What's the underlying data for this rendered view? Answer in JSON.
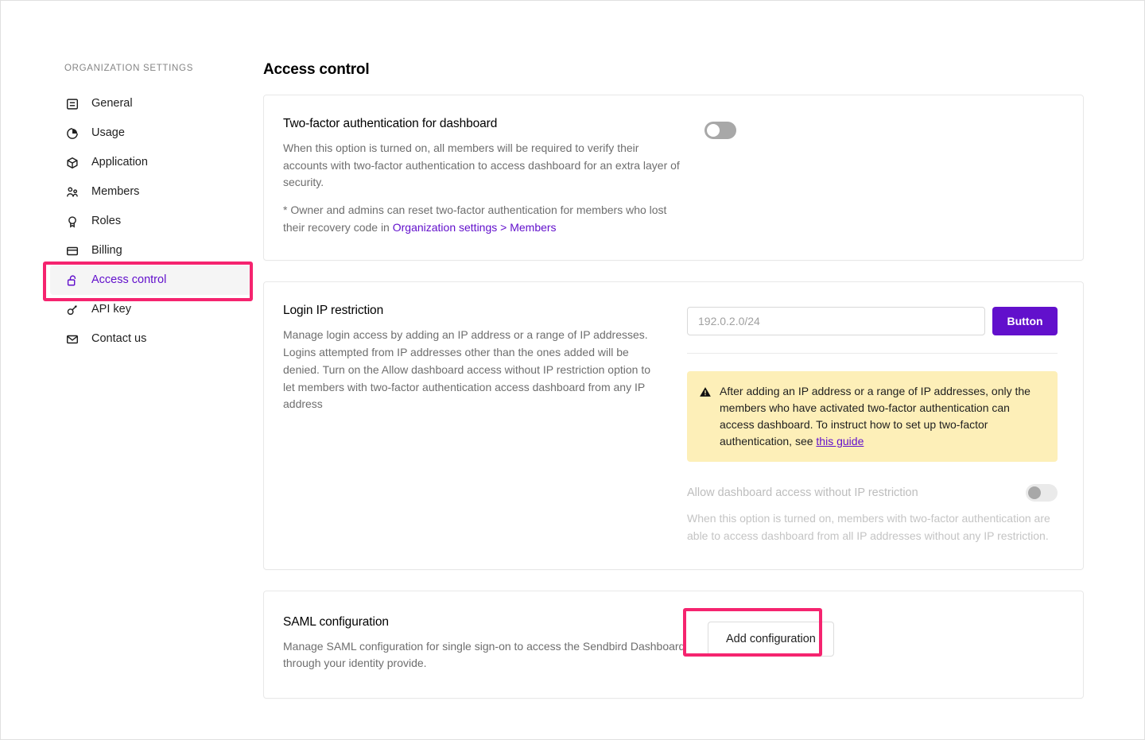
{
  "sidebar": {
    "heading": "ORGANIZATION SETTINGS",
    "items": [
      {
        "label": "General",
        "icon": "document-icon",
        "active": false
      },
      {
        "label": "Usage",
        "icon": "pie-chart-icon",
        "active": false
      },
      {
        "label": "Application",
        "icon": "cube-icon",
        "active": false
      },
      {
        "label": "Members",
        "icon": "members-icon",
        "active": false
      },
      {
        "label": "Roles",
        "icon": "badge-icon",
        "active": false
      },
      {
        "label": "Billing",
        "icon": "credit-card-icon",
        "active": false
      },
      {
        "label": "Access control",
        "icon": "unlock-icon",
        "active": true
      },
      {
        "label": "API key",
        "icon": "key-icon",
        "active": false
      },
      {
        "label": "Contact us",
        "icon": "envelope-icon",
        "active": false
      }
    ]
  },
  "main": {
    "page_title": "Access control",
    "two_factor": {
      "title": "Two-factor authentication for dashboard",
      "description": "When this option is turned on, all members will be required to verify their accounts with two-factor authentication to access dashboard for an extra layer of security.",
      "note_prefix": "* Owner and admins can reset two-factor authentication for members who lost their recovery code in ",
      "note_link": "Organization settings > Members",
      "toggle_state": "off"
    },
    "login_ip": {
      "title": "Login IP restriction",
      "description": "Manage login access by adding an IP address or a range of IP addresses. Logins attempted from IP addresses other than the ones added will be denied. Turn on the Allow dashboard access without IP restriction option to let members with two-factor authentication access dashboard from any IP address",
      "input_placeholder": "192.0.2.0/24",
      "input_value": "",
      "button_label": "Button",
      "warning_icon": "warning-triangle-icon",
      "warning_text": "After adding an IP address or a range of IP addresses, only the members who have activated two-factor authentication can access dashboard. To instruct how to set up two-factor authentication, see ",
      "warning_link": "this guide",
      "allow_title": "Allow dashboard access without IP restriction",
      "allow_body": "When this option is turned on, members with two-factor authentication are able to access dashboard from all IP addresses without any IP restriction.",
      "allow_toggle_state": "off-disabled"
    },
    "saml": {
      "title": "SAML configuration",
      "description": "Manage SAML configuration for single sign-on to access the Sendbird Dashboard through your identity provide.",
      "button_label": "Add configuration"
    }
  },
  "annotations": {
    "highlight_color": "#f5246f",
    "highlighted_sidebar_item": "Access control",
    "highlighted_button": "Add configuration"
  },
  "colors": {
    "accent_purple": "#6210cc",
    "highlight_pink": "#f5246f",
    "warning_yellow": "#fdefb8",
    "active_nav_bg": "#f5f5f5"
  }
}
